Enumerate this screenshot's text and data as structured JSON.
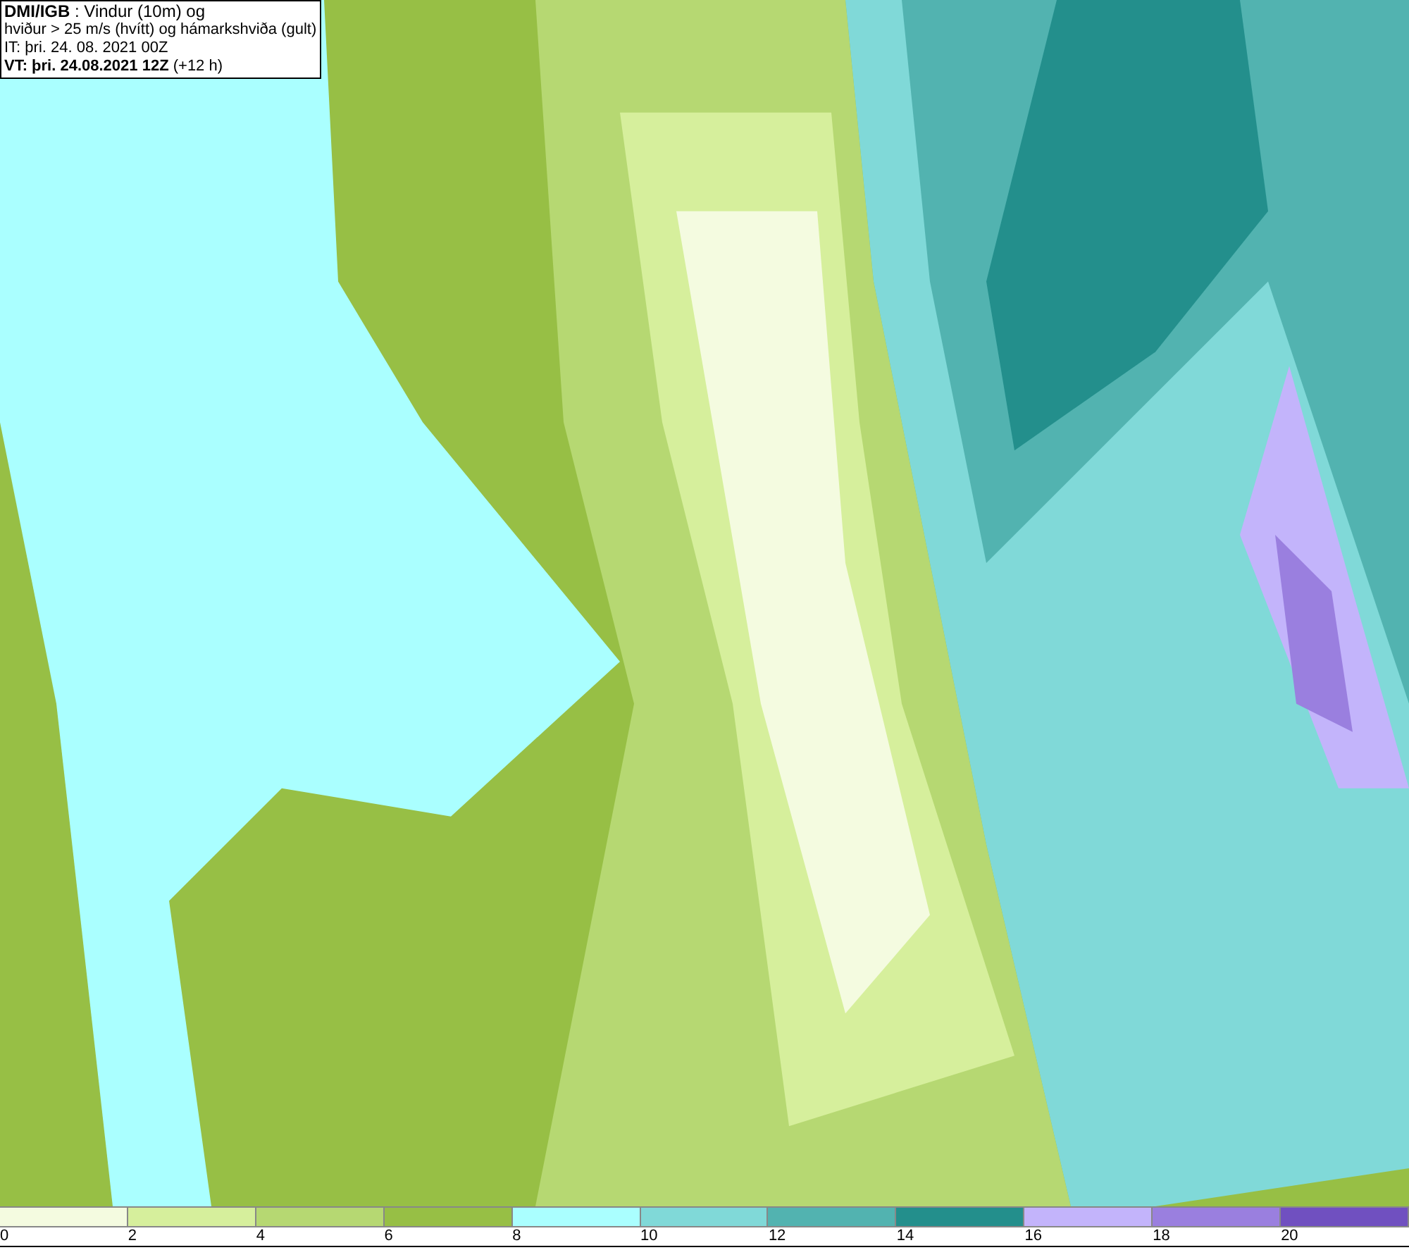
{
  "header": {
    "lines": [
      "**DMI/IGB** : Vindur (10m) og",
      "hviður > 25 m/s (hvítt) og hámarkshviða (gult)",
      "IT: þri. 24. 08. 2021 00Z",
      "**VT: þri. 24.08.2021 12Z** (+12 h)"
    ]
  },
  "legend": {
    "bins": [
      {
        "label": "0",
        "color": "#f4fbe0"
      },
      {
        "label": "2",
        "color": "#d6ef9c"
      },
      {
        "label": "4",
        "color": "#b6d872"
      },
      {
        "label": "6",
        "color": "#97bf45"
      },
      {
        "label": "8",
        "color": "#aaffff"
      },
      {
        "label": "10",
        "color": "#80d9d8"
      },
      {
        "label": "12",
        "color": "#52b3b0"
      },
      {
        "label": "14",
        "color": "#238f8c"
      },
      {
        "label": "16",
        "color": "#c3b4fb"
      },
      {
        "label": "18",
        "color": "#9a7fdf"
      },
      {
        "label": "20",
        "color": "#7050c0"
      }
    ]
  }
}
